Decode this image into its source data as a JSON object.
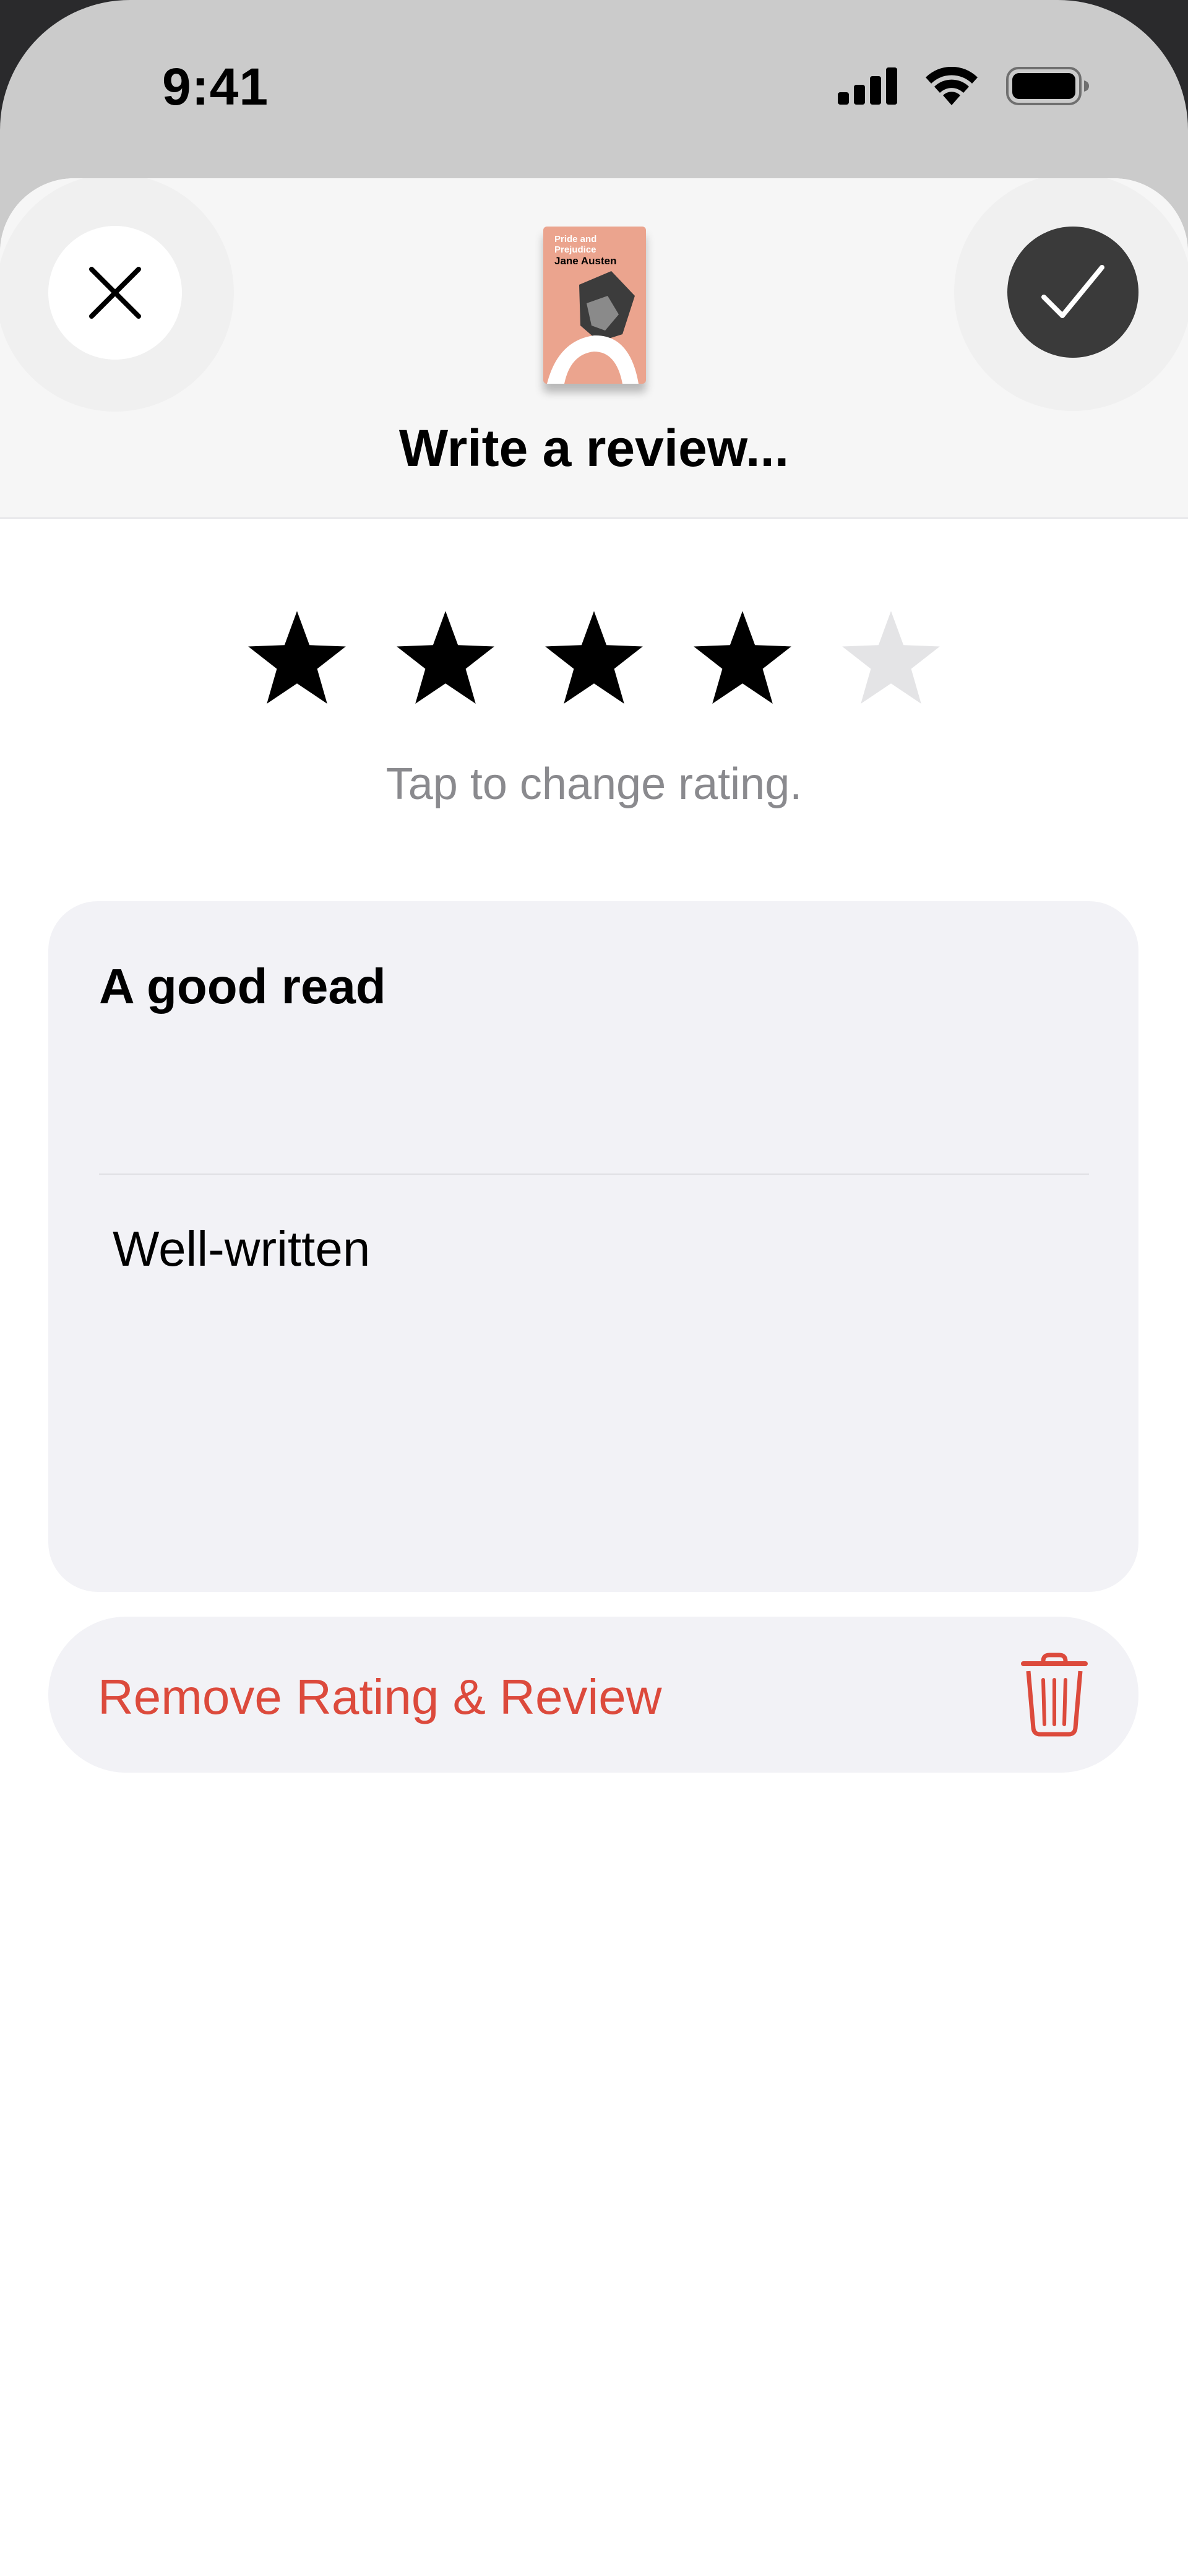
{
  "status_bar": {
    "time": "9:41",
    "icons": [
      "cellular-signal-icon",
      "wifi-icon",
      "battery-icon"
    ]
  },
  "header": {
    "close_icon": "close-icon",
    "done_icon": "checkmark-icon",
    "title": "Write a review...",
    "book": {
      "title": "Pride and Prejudice",
      "author": "Jane Austen"
    }
  },
  "rating": {
    "value": 4,
    "max": 5,
    "hint": "Tap to change rating."
  },
  "review": {
    "title": "A good read",
    "body": "Well-written"
  },
  "remove": {
    "label": "Remove Rating & Review",
    "icon": "trash-icon"
  },
  "colors": {
    "star_filled": "#000000",
    "star_empty": "#e4e4e6",
    "destructive": "#dc4a3c",
    "card_background": "#f2f2f6",
    "book_cover": "#eba48e"
  }
}
